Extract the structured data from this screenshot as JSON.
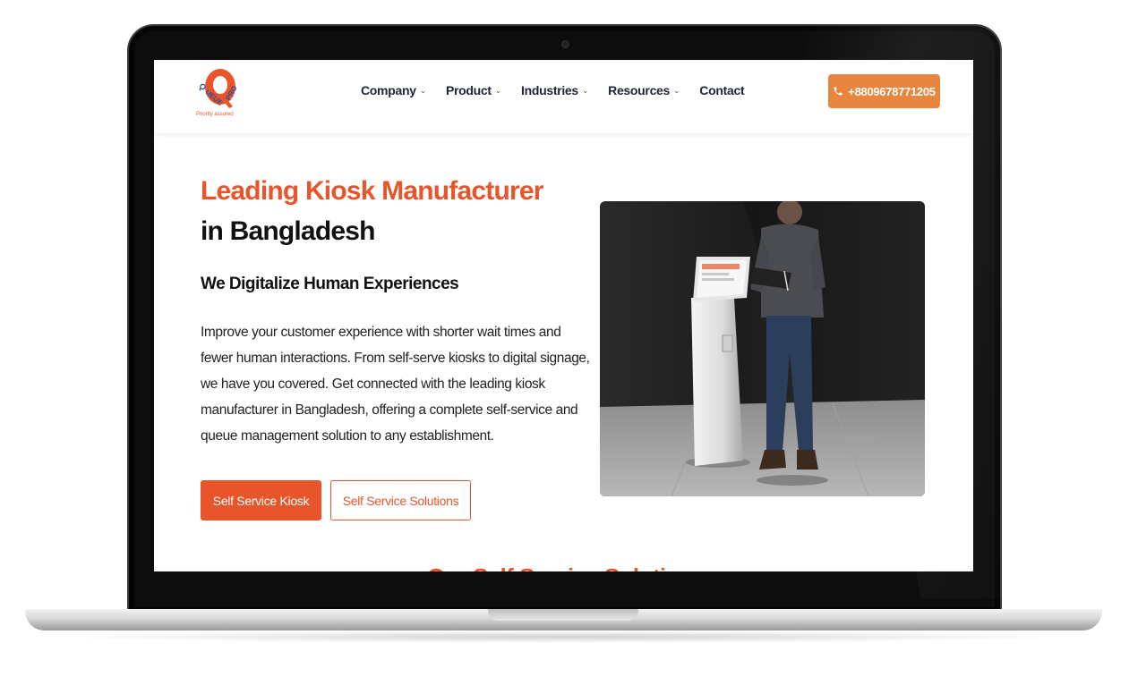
{
  "logo": {
    "brand": "QUEUE PRO",
    "tagline": "Priority assured"
  },
  "nav": {
    "items": [
      {
        "label": "Company",
        "has_dropdown": true
      },
      {
        "label": "Product",
        "has_dropdown": true
      },
      {
        "label": "Industries",
        "has_dropdown": true
      },
      {
        "label": "Resources",
        "has_dropdown": true
      },
      {
        "label": "Contact",
        "has_dropdown": false
      }
    ],
    "chevron": "⌄",
    "phone": "+8809678771205",
    "phone_icon": "phone-icon"
  },
  "hero": {
    "title_line1": "Leading Kiosk Manufacturer",
    "title_line2": "in Bangladesh",
    "subtitle": "We Digitalize Human Experiences",
    "body": "Improve your customer experience with shorter wait times and fewer human interactions. From self-serve kiosks to digital signage, we have you covered. Get connected with the leading kiosk manufacturer in Bangladesh, offering a complete self-service and queue management solution to any establishment.",
    "primary_button": "Self Service Kiosk",
    "secondary_button": "Self Service Solutions"
  },
  "next_section": {
    "heading": "Our Self Service Solutions"
  },
  "colors": {
    "accent": "#e8552a",
    "phone_button": "#e8853e",
    "text_dark": "#111111"
  }
}
